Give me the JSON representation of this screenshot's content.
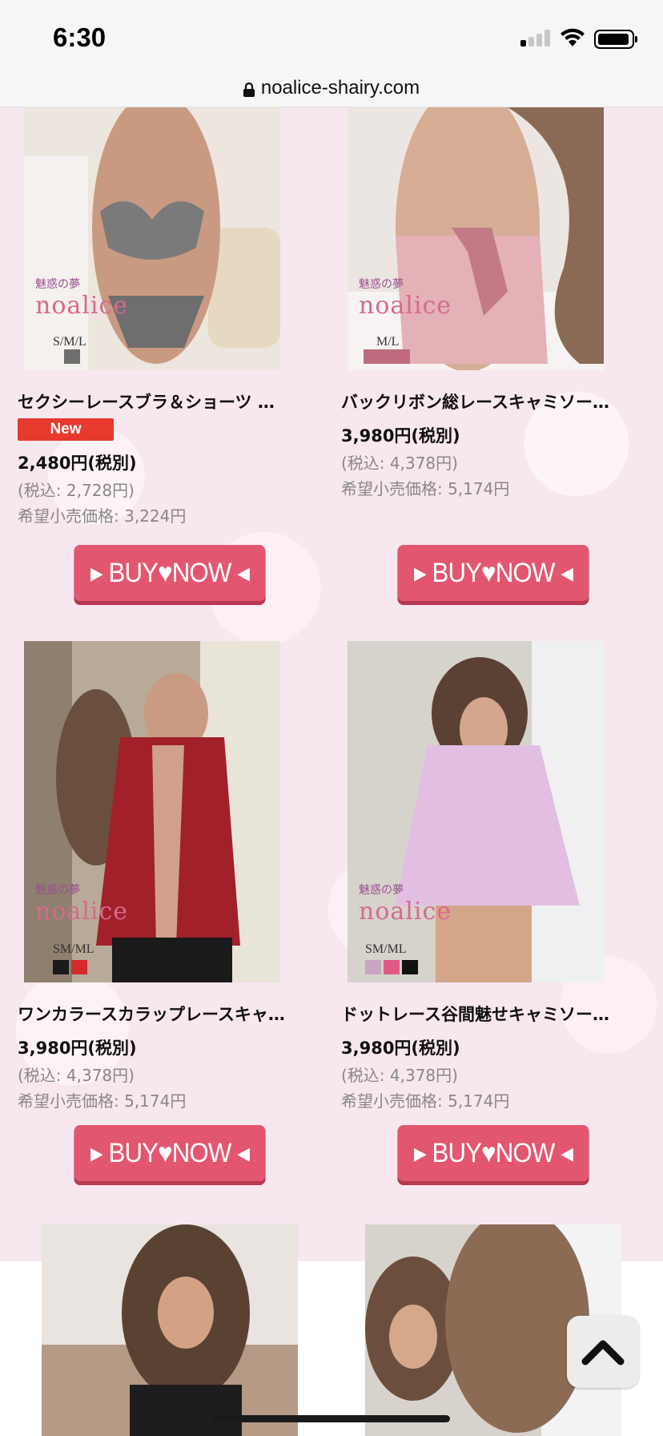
{
  "status_bar": {
    "time": "6:30"
  },
  "browser": {
    "url": "noalice-shairy.com"
  },
  "brand": {
    "jp_line": "魅惑の夢",
    "logo": "noalice"
  },
  "products": [
    {
      "title": "セクシーレースブラ＆ショーツ ゆき…",
      "badge": "New",
      "price": "2,480円(税別)",
      "tax_included": "(税込: 2,728円)",
      "msrp": "希望小売価格: 3,224円",
      "sizes": "S/M/L",
      "swatches": [
        "#6f6f6f"
      ],
      "button": "▸ BUY♥NOW ◂"
    },
    {
      "title": "バックリボン総レースキャミソールベ…",
      "badge": "",
      "price": "3,980円(税別)",
      "tax_included": "(税込: 4,378円)",
      "msrp": "希望小売価格: 5,174円",
      "sizes": "M/L",
      "swatches": [
        "#c06a7f",
        "#c06a7f"
      ],
      "button": "▸ BUY♥NOW ◂"
    },
    {
      "title": "ワンカラースカラップレースキャミソ…",
      "badge": "",
      "price": "3,980円(税別)",
      "tax_included": "(税込: 4,378円)",
      "msrp": "希望小売価格: 5,174円",
      "sizes": "SM/ML",
      "swatches": [
        "#1a1a1a",
        "#d42a2a"
      ],
      "button": "▸ BUY♥NOW ◂"
    },
    {
      "title": "ドットレース谷間魅せキャミソールベ…",
      "badge": "",
      "price": "3,980円(税別)",
      "tax_included": "(税込: 4,378円)",
      "msrp": "希望小売価格: 5,174円",
      "sizes": "SM/ML",
      "swatches": [
        "#c9a6c2",
        "#e05a86",
        "#111111"
      ],
      "button": "▸ BUY♥NOW ◂"
    }
  ],
  "scroll_top": {
    "icon": "chevron-up-icon"
  }
}
